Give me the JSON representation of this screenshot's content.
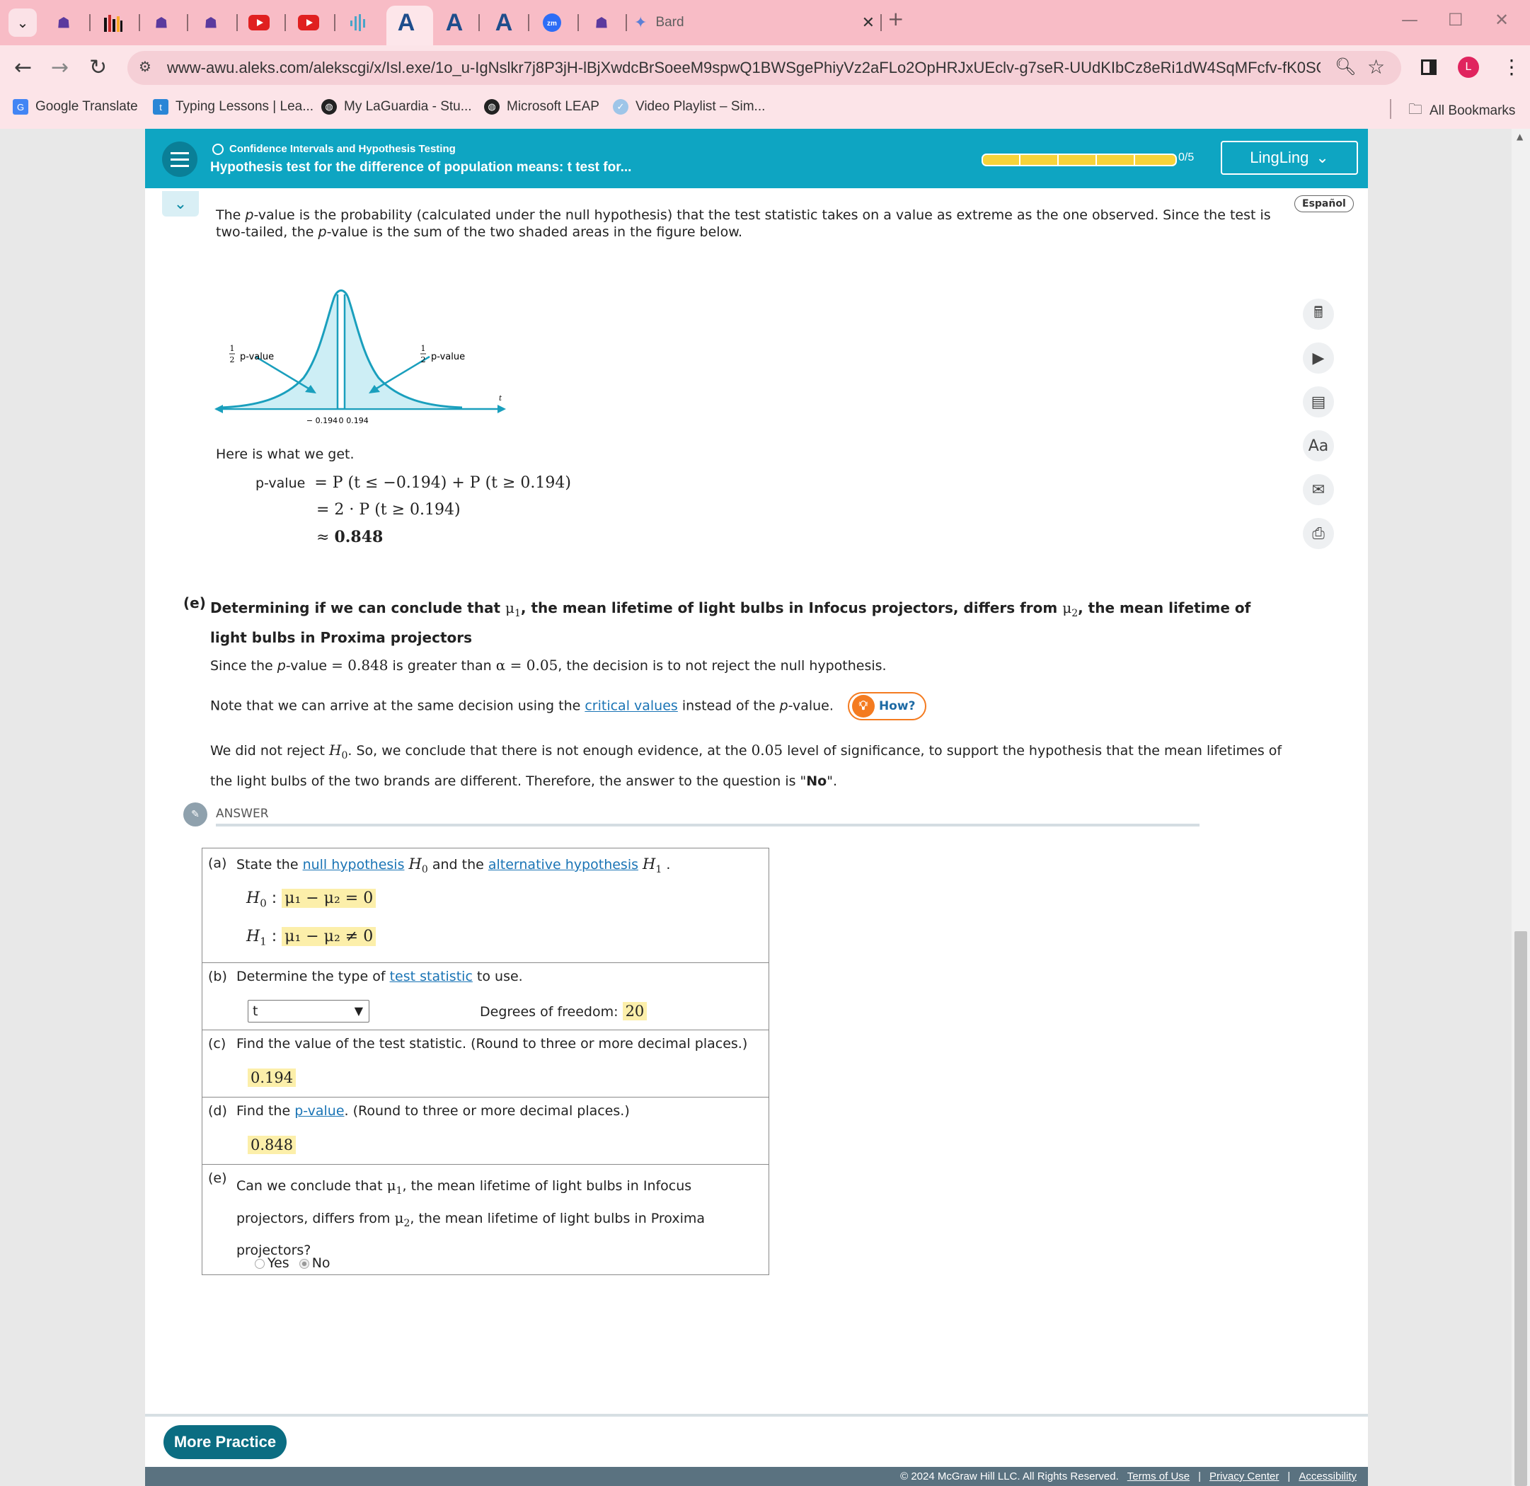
{
  "browser": {
    "tab_bard": "Bard",
    "url": "www-awu.aleks.com/alekscgi/x/Isl.exe/1o_u-IgNslkr7j8P3jH-lBjXwdcBrSoeeM9spwQ1BWSgePhiyVz2aFLo2OpHRJxUEclv-g7seR-UUdKIbCz8eRi1dW4SqMFcfv-fK0SQEy3qyVpdQI...",
    "bookmarks": [
      "Google Translate",
      "Typing Lessons | Lea...",
      "My LaGuardia - Stu...",
      "Microsoft LEAP",
      "Video Playlist – Sim..."
    ],
    "all_bookmarks": "All Bookmarks",
    "profile_initial": "L"
  },
  "header": {
    "topic": "Confidence Intervals and Hypothesis Testing",
    "title": "Hypothesis test for the difference of population means: t test for...",
    "progress_label": "0/5",
    "progress_value": 0,
    "user": "LingLing"
  },
  "content": {
    "espanol": "Español",
    "pvalue_intro_1": "The ",
    "pvalue_intro_p": "p",
    "pvalue_intro_2": "-value is the probability (calculated under the null hypothesis) that the test statistic takes on a value as extreme as the one observed. Since the test is two-tailed, the ",
    "pvalue_intro_3": "-value is the sum of the two shaded areas in the figure below.",
    "figure": {
      "half_num": "1",
      "half_den": "2",
      "left_label": "p-value",
      "right_label": "p-value",
      "t_label": "t",
      "tick_neg": "− 0.194",
      "tick_zero": "0",
      "tick_pos": "0.194"
    },
    "here_is": "Here is what we get.",
    "calc": {
      "lhs": "p-value",
      "line1": "= P (t ≤ −0.194) + P (t ≥ 0.194)",
      "line2": "= 2 · P (t ≥ 0.194)",
      "line3_sym": "≈",
      "line3_val": "0.848"
    },
    "part_e": {
      "label": "(e)",
      "title_1": "Determining if we can conclude that ",
      "mu1": "μ",
      "sub1": "1",
      "title_2": ", the mean lifetime of light bulbs in Infocus projectors, differs from ",
      "sub2": "2",
      "title_3": ", the mean lifetime of light bulbs in Proxima projectors",
      "since_1": "Since the ",
      "since_2": "-value ",
      "since_val": "= 0.848",
      "since_3": " is greater than ",
      "since_alpha": "α = 0.05",
      "since_4": ", the decision is to not reject the null hypothesis.",
      "note_1": "Note that we can arrive at the same decision using the ",
      "note_link": "critical values",
      "note_2": " instead of the ",
      "note_3": "-value.",
      "how": "How?",
      "concl_1": "We did not reject ",
      "concl_H": "H",
      "concl_sub": "0",
      "concl_2": ". So, we conclude that there is not enough evidence, at the ",
      "concl_level": "0.05",
      "concl_3": " level of significance, to support the hypothesis that the mean lifetimes of the light bulbs of the two brands are different. Therefore, the answer to the question is \"",
      "concl_no": "No",
      "concl_4": "\"."
    }
  },
  "answer": {
    "label": "ANSWER",
    "a": {
      "tag": "(a)",
      "q_1": "State the ",
      "q_link1": "null hypothesis",
      "q_2": " and the ",
      "q_link2": "alternative hypothesis",
      "H0": "H",
      "sub0": "0",
      "sub1": "1",
      "h0_expr": "μ₁ − μ₂  = 0",
      "h1_expr": "μ₁ − μ₂  ≠ 0"
    },
    "b": {
      "tag": "(b)",
      "q_1": "Determine the type of ",
      "q_link": "test statistic",
      "q_2": " to use.",
      "select_value": "t",
      "df_label": "Degrees of freedom:",
      "df_value": "20"
    },
    "c": {
      "tag": "(c)",
      "q": "Find the value of the test statistic. (Round to three or more decimal places.)",
      "value": "0.194"
    },
    "d": {
      "tag": "(d)",
      "q_1": "Find the ",
      "q_link": "p-value",
      "q_2": ". (Round to three or more decimal places.)",
      "value": "0.848"
    },
    "e": {
      "tag": "(e)",
      "q_1": "Can we conclude that ",
      "q_2": ", the mean lifetime of light bulbs in Infocus",
      "q_3": "projectors, differs from ",
      "q_4": ", the mean lifetime of light bulbs in Proxima",
      "q_5": "projectors?",
      "opt_yes": "Yes",
      "opt_no": "No",
      "selected": "No"
    }
  },
  "footer": {
    "more_practice": "More Practice",
    "copyright": "© 2024 McGraw Hill LLC. All Rights Reserved.",
    "terms": "Terms of Use",
    "privacy": "Privacy Center",
    "accessibility": "Accessibility"
  }
}
